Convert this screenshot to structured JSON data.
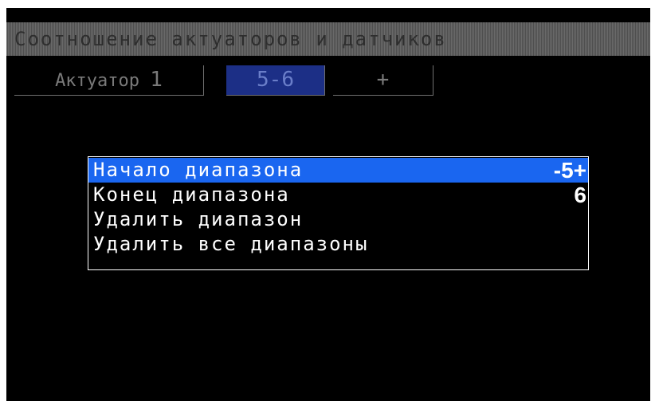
{
  "header": {
    "title": "Соотношение актуаторов и датчиков"
  },
  "tabs": [
    {
      "label": "Актуатор",
      "number": "1",
      "selected": false
    },
    {
      "label": "5-6",
      "selected": true
    },
    {
      "label": "+",
      "selected": false
    }
  ],
  "menu": {
    "items": [
      {
        "label": "Начало диапазона",
        "value": "-5+",
        "highlighted": true
      },
      {
        "label": "Конец диапазона",
        "value": "6",
        "highlighted": false
      },
      {
        "label": "Удалить диапазон",
        "value": "",
        "highlighted": false
      },
      {
        "label": "Удалить все диапазоны",
        "value": "",
        "highlighted": false
      }
    ]
  },
  "colors": {
    "background": "#000000",
    "highlight": "#1a66f0",
    "selected_tab": "#1c2f86",
    "menu_border": "#ffffff"
  }
}
